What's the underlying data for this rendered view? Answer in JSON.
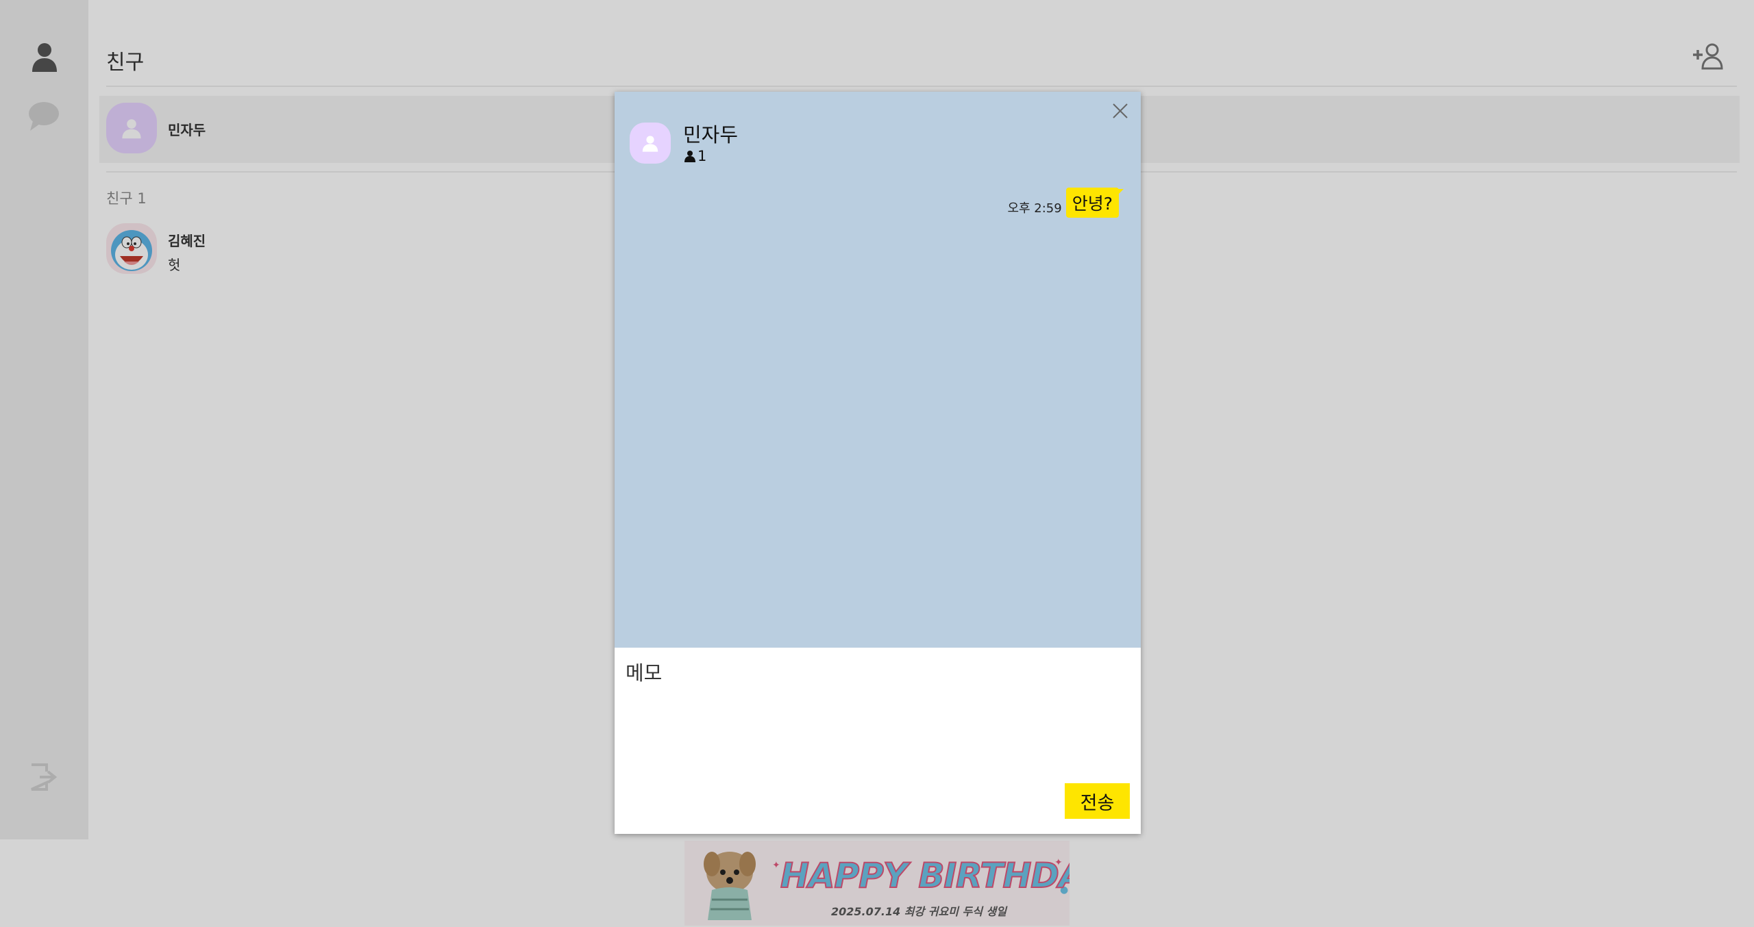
{
  "sidebar": {
    "icons": [
      "person-icon",
      "chat-bubble-icon",
      "logout-icon"
    ]
  },
  "header": {
    "title": "친구",
    "add_friend_icon": "add-friend-icon"
  },
  "my_profile": {
    "name": "민자두"
  },
  "friends": {
    "section_label": "친구 1",
    "items": [
      {
        "name": "김혜진",
        "status": "헛"
      }
    ]
  },
  "banner": {
    "headline": "HAPPY BIRTHDAY",
    "subtitle": "2025.07.14 최강 귀요미 두식 생일"
  },
  "chat_modal": {
    "room_name": "민자두",
    "member_count": "1",
    "messages": [
      {
        "time": "오후 2:59",
        "text": "안녕?",
        "mine": true
      }
    ],
    "input_placeholder": "메모",
    "send_label": "전송"
  },
  "colors": {
    "accent_yellow": "#fee500",
    "chat_background": "#bacee0",
    "avatar_purple": "#e6d3ff",
    "sidebar_bg": "#ececec"
  }
}
